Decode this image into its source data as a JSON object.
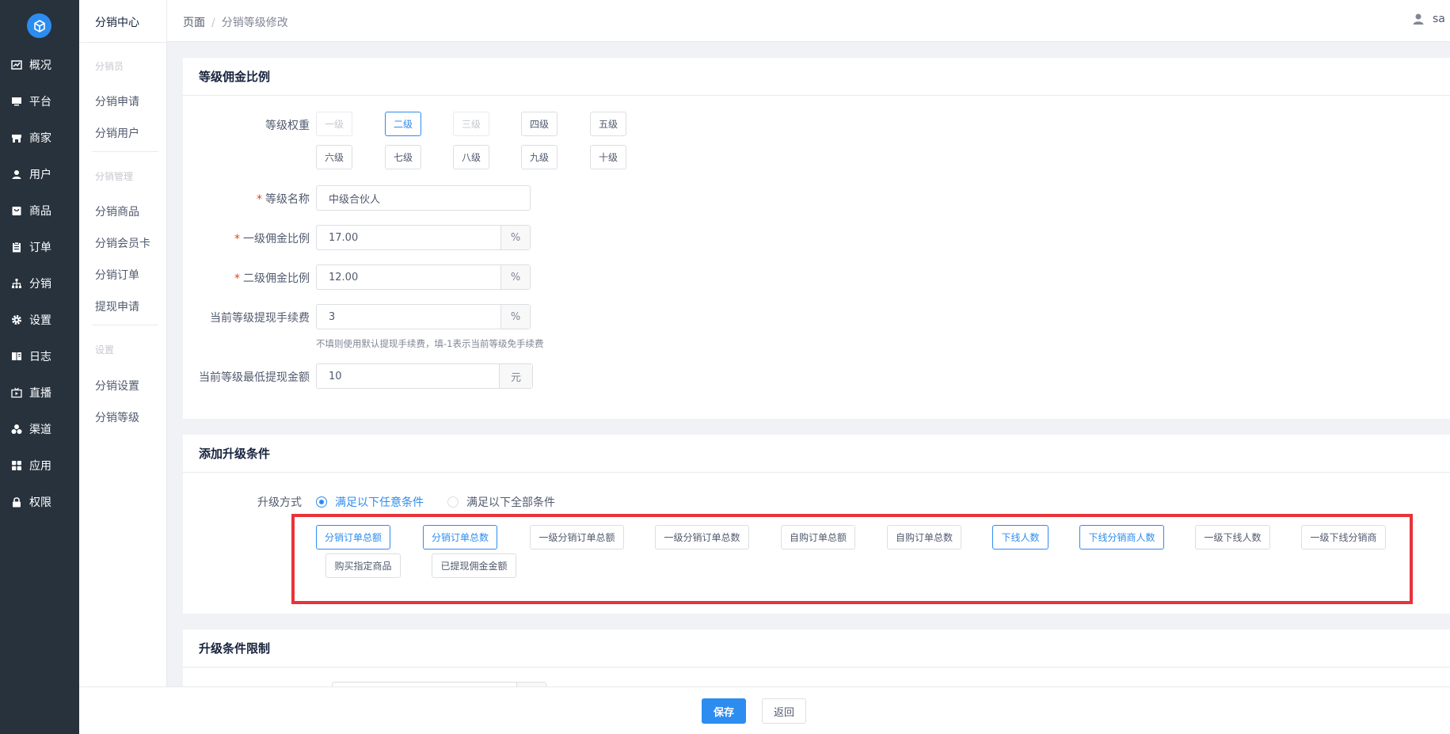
{
  "sidebar": {
    "items": [
      {
        "label": "概况",
        "icon": "chart-icon"
      },
      {
        "label": "平台",
        "icon": "monitor-icon"
      },
      {
        "label": "商家",
        "icon": "store-icon"
      },
      {
        "label": "用户",
        "icon": "user-icon"
      },
      {
        "label": "商品",
        "icon": "bag-icon"
      },
      {
        "label": "订单",
        "icon": "clipboard-icon"
      },
      {
        "label": "分销",
        "icon": "hierarchy-icon"
      },
      {
        "label": "设置",
        "icon": "gear-icon"
      },
      {
        "label": "日志",
        "icon": "book-icon"
      },
      {
        "label": "直播",
        "icon": "tv-icon"
      },
      {
        "label": "渠道",
        "icon": "cluster-icon"
      },
      {
        "label": "应用",
        "icon": "grid-icon"
      },
      {
        "label": "权限",
        "icon": "lock-icon"
      }
    ]
  },
  "submenu": {
    "title": "分销中心",
    "group1": "分销员",
    "apply": "分销申请",
    "users": "分销用户",
    "group2": "分销管理",
    "goods": "分销商品",
    "card": "分销会员卡",
    "orders": "分销订单",
    "withdraw": "提现申请",
    "group3": "设置",
    "settings": "分销设置",
    "levels": "分销等级"
  },
  "header": {
    "crumb1": "页面",
    "sep": "/",
    "crumb2": "分销等级修改",
    "user": "sa"
  },
  "section1": {
    "title": "等级佣金比例",
    "weight_label": "等级权重",
    "levels": [
      "一级",
      "二级",
      "三级",
      "四级",
      "五级",
      "六级",
      "七级",
      "八级",
      "九级",
      "十级"
    ],
    "active_level": "二级",
    "disabled_levels": [
      "一级",
      "三级"
    ],
    "name_label": "等级名称",
    "name_value": "中级合伙人",
    "first_label": "一级佣金比例",
    "first_value": "17.00",
    "second_label": "二级佣金比例",
    "second_value": "12.00",
    "percent": "%",
    "fee_label": "当前等级提现手续费",
    "fee_value": "3",
    "fee_hint": "不填则使用默认提现手续费，填-1表示当前等级免手续费",
    "min_label": "当前等级最低提现金额",
    "min_value": "10",
    "yuan": "元"
  },
  "section2": {
    "title": "添加升级条件",
    "mode_label": "升级方式",
    "mode_any": "满足以下任意条件",
    "mode_all": "满足以下全部条件",
    "conditions": [
      {
        "label": "分销订单总额",
        "active": true
      },
      {
        "label": "分销订单总数",
        "active": true
      },
      {
        "label": "一级分销订单总额",
        "active": false
      },
      {
        "label": "一级分销订单总数",
        "active": false
      },
      {
        "label": "自购订单总额",
        "active": false
      },
      {
        "label": "自购订单总数",
        "active": false
      },
      {
        "label": "下线人数",
        "active": true
      },
      {
        "label": "下线分销商人数",
        "active": true
      },
      {
        "label": "一级下线人数",
        "active": false
      },
      {
        "label": "一级下线分销商",
        "active": false
      },
      {
        "label": "购买指定商品",
        "active": false
      },
      {
        "label": "已提现佣金金额",
        "active": false
      }
    ]
  },
  "section3": {
    "title": "升级条件限制"
  },
  "footer": {
    "save": "保存",
    "back": "返回"
  },
  "colors": {
    "sidebar": "#27323d",
    "primary": "#2d8cf0",
    "highlight": "#e8333a"
  }
}
